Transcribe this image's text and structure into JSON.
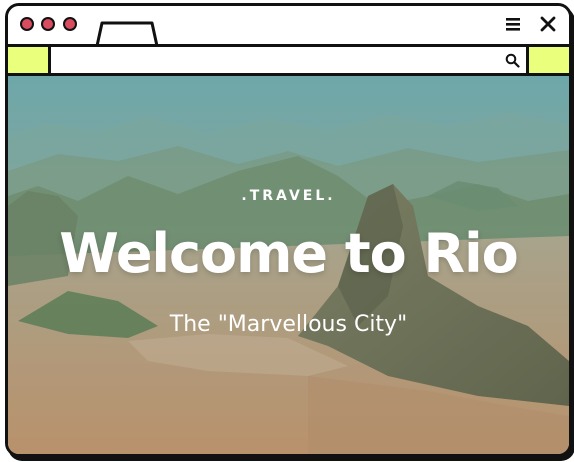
{
  "window": {
    "traffic_lights_color": "#d94b5e",
    "accent_color": "#eaff7c",
    "tab_label": ""
  },
  "address_bar": {
    "url_value": "",
    "url_placeholder": ""
  },
  "hero": {
    "kicker": ".TRAVEL.",
    "headline": "Welcome to Rio",
    "subtitle": "The \"Marvellous City\""
  },
  "icons": {
    "menu": "hamburger-menu-icon",
    "close": "close-icon",
    "search": "search-icon"
  }
}
